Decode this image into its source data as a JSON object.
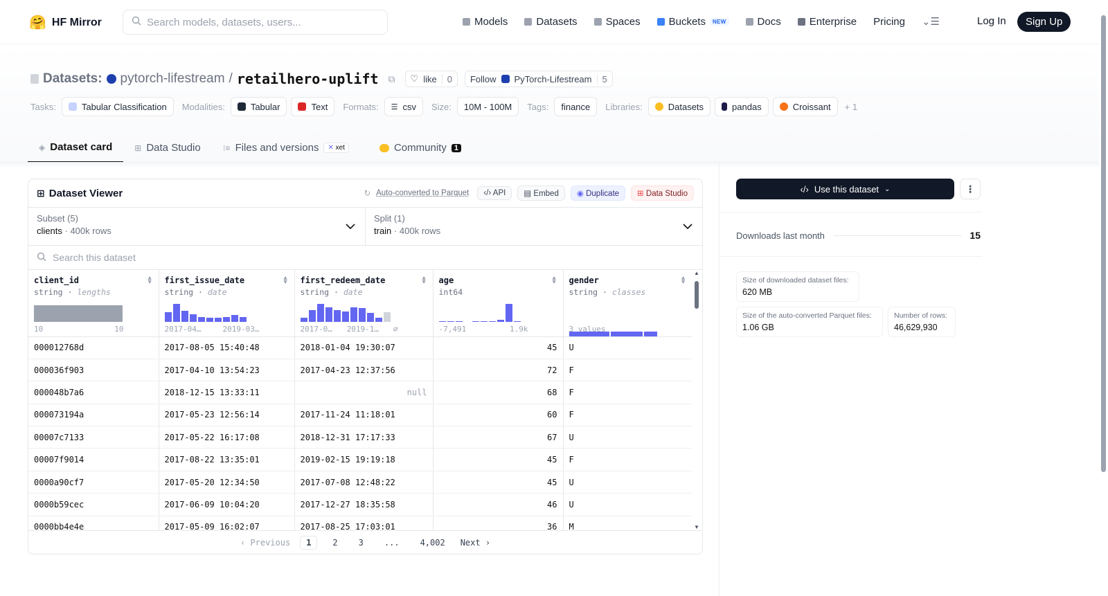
{
  "header": {
    "brand": "HF Mirror",
    "search_placeholder": "Search models, datasets, users...",
    "nav": [
      "Models",
      "Datasets",
      "Spaces",
      "Buckets",
      "Docs",
      "Enterprise",
      "Pricing"
    ],
    "new_badge": "NEW",
    "login": "Log In",
    "signup": "Sign Up"
  },
  "repo": {
    "prefix": "Datasets:",
    "org": "pytorch-lifestream",
    "slash": "/",
    "name": "retailhero-uplift",
    "like_label": "like",
    "like_count": "0",
    "follow_label": "Follow",
    "follow_org": "PyTorch-Lifestream",
    "follow_count": "5"
  },
  "tags": {
    "tasks_label": "Tasks:",
    "task": "Tabular Classification",
    "modalities_label": "Modalities:",
    "modalities": [
      "Tabular",
      "Text"
    ],
    "formats_label": "Formats:",
    "format": "csv",
    "size_label": "Size:",
    "size": "10M - 100M",
    "tags_label": "Tags:",
    "tag": "finance",
    "libraries_label": "Libraries:",
    "libraries": [
      "Datasets",
      "pandas",
      "Croissant"
    ],
    "more": "+ 1"
  },
  "tabs": {
    "card": "Dataset card",
    "studio": "Data Studio",
    "files": "Files and versions",
    "xet": "xet",
    "community": "Community",
    "community_count": "1"
  },
  "viewer": {
    "title": "Dataset Viewer",
    "auto": "Auto-converted to Parquet",
    "api": "API",
    "embed": "Embed",
    "duplicate": "Duplicate",
    "data_studio": "Data Studio",
    "subset_label": "Subset (5)",
    "subset_value": "clients",
    "subset_rows": "400k rows",
    "split_label": "Split (1)",
    "split_value": "train",
    "split_rows": "400k rows",
    "search_placeholder": "Search this dataset",
    "columns": [
      {
        "name": "client_id",
        "type": "string",
        "hint": "lengths",
        "min": "10",
        "max": "10"
      },
      {
        "name": "first_issue_date",
        "type": "string",
        "hint": "date",
        "min": "2017-04…",
        "max": "2019-03…"
      },
      {
        "name": "first_redeem_date",
        "type": "string",
        "hint": "date",
        "min": "2017-0…",
        "max": "2019-1…"
      },
      {
        "name": "age",
        "type": "int64",
        "hint": "",
        "min": "-7,491",
        "max": "1.9k"
      },
      {
        "name": "gender",
        "type": "string",
        "hint": "classes",
        "min": "3 values",
        "max": ""
      }
    ],
    "null_mark": "⌀",
    "rows": [
      [
        "000012768d",
        "2017-08-05 15:40:48",
        "2018-01-04 19:30:07",
        "45",
        "U"
      ],
      [
        "000036f903",
        "2017-04-10 13:54:23",
        "2017-04-23 12:37:56",
        "72",
        "F"
      ],
      [
        "000048b7a6",
        "2018-12-15 13:33:11",
        "null",
        "68",
        "F"
      ],
      [
        "000073194a",
        "2017-05-23 12:56:14",
        "2017-11-24 11:18:01",
        "60",
        "F"
      ],
      [
        "00007c7133",
        "2017-05-22 16:17:08",
        "2018-12-31 17:17:33",
        "67",
        "U"
      ],
      [
        "00007f9014",
        "2017-08-22 13:35:01",
        "2019-02-15 19:19:18",
        "45",
        "F"
      ],
      [
        "0000a90cf7",
        "2017-05-20 12:34:50",
        "2017-07-08 12:48:22",
        "45",
        "U"
      ],
      [
        "0000b59cec",
        "2017-06-09 10:04:20",
        "2017-12-27 18:35:58",
        "46",
        "U"
      ],
      [
        "0000bb4e4e",
        "2017-05-09 16:02:07",
        "2017-08-25 17:03:01",
        "36",
        "M"
      ]
    ],
    "pager": {
      "prev": "Previous",
      "pages": [
        "1",
        "2",
        "3",
        "...",
        "4,002"
      ],
      "next": "Next"
    }
  },
  "side": {
    "use_button": "Use this dataset",
    "downloads_label": "Downloads last month",
    "downloads_value": "15",
    "dl_size_label": "Size of downloaded dataset files:",
    "dl_size_value": "620 MB",
    "parquet_label": "Size of the auto-converted Parquet files:",
    "parquet_value": "1.06 GB",
    "rows_label": "Number of rows:",
    "rows_value": "46,629,930"
  },
  "colors": {
    "accent": "#6366f1",
    "dark": "#111827"
  }
}
